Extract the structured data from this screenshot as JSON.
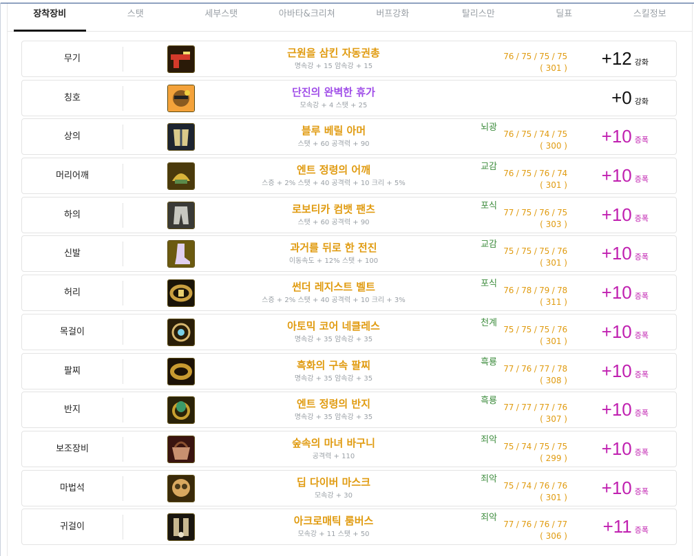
{
  "tabs": [
    "장착장비",
    "스탯",
    "세부스탯",
    "아바타&크리쳐",
    "버프강화",
    "탈리스만",
    "딜표",
    "스킬정보"
  ],
  "active_tab": 0,
  "items": [
    {
      "slot": "무기",
      "name": "근원을 삼킨 자동권총",
      "options": "명속강 + 15 암속강 + 15",
      "emblem": "",
      "stat_line": "76 / 75 / 75 / 75",
      "stat_total": "( 301 )",
      "level": "+12",
      "level_tag": "강화",
      "tier": "legend",
      "mod": "black",
      "icon": "pistol-icon",
      "icon_bg": "#2a1a08",
      "icon_fg": "#d33a2a"
    },
    {
      "slot": "칭호",
      "name": "단진의 완벽한 휴가",
      "options": "모속강 + 4 스탯 + 25",
      "emblem": "",
      "stat_line": "",
      "stat_total": "",
      "level": "+0",
      "level_tag": "강화",
      "tier": "epic",
      "mod": "black",
      "icon": "title-icon",
      "icon_bg": "#f4a23a",
      "icon_fg": "#8a5a20"
    },
    {
      "slot": "상의",
      "name": "블루 베릴 아머",
      "options": "스탯 + 60 공격력 + 90",
      "emblem": "뇌광",
      "stat_line": "76 / 75 / 74 / 75",
      "stat_total": "( 300 )",
      "level": "+10",
      "level_tag": "증폭",
      "tier": "legend",
      "mod": "amp",
      "icon": "armor-icon",
      "icon_bg": "#1d2430",
      "icon_fg": "#d9c98a"
    },
    {
      "slot": "머리어깨",
      "name": "엔트 정령의 어깨",
      "options": "스증 + 2% 스탯 + 40 공격력 + 10 크리 + 5%",
      "emblem": "교감",
      "stat_line": "76 / 75 / 76 / 74",
      "stat_total": "( 301 )",
      "level": "+10",
      "level_tag": "증폭",
      "tier": "legend",
      "mod": "amp",
      "icon": "shoulder-icon",
      "icon_bg": "#4a3a0c",
      "icon_fg": "#d8b43a"
    },
    {
      "slot": "하의",
      "name": "로보티카 컴뱃 팬츠",
      "options": "스탯 + 60 공격력 + 90",
      "emblem": "포식",
      "stat_line": "77 / 75 / 76 / 75",
      "stat_total": "( 303 )",
      "level": "+10",
      "level_tag": "증폭",
      "tier": "legend",
      "mod": "amp",
      "icon": "pants-icon",
      "icon_bg": "#3a3a36",
      "icon_fg": "#c8c8c0"
    },
    {
      "slot": "신발",
      "name": "과거를 뒤로 한 전진",
      "options": "이동속도 + 12% 스탯 + 100",
      "emblem": "교감",
      "stat_line": "75 / 75 / 75 / 76",
      "stat_total": "( 301 )",
      "level": "+10",
      "level_tag": "증폭",
      "tier": "legend",
      "mod": "amp",
      "icon": "boots-icon",
      "icon_bg": "#6b5a10",
      "icon_fg": "#e0d0f0"
    },
    {
      "slot": "허리",
      "name": "썬더 레지스트 벨트",
      "options": "스증 + 2% 스탯 + 40 공격력 + 10 크리 + 3%",
      "emblem": "포식",
      "stat_line": "76 / 78 / 79 / 78",
      "stat_total": "( 311 )",
      "level": "+10",
      "level_tag": "증폭",
      "tier": "legend",
      "mod": "amp",
      "icon": "belt-icon",
      "icon_bg": "#1a1408",
      "icon_fg": "#caa040"
    },
    {
      "slot": "목걸이",
      "name": "아토믹 코어 네클레스",
      "options": "명속강 + 35 암속강 + 35",
      "emblem": "천계",
      "stat_line": "75 / 75 / 75 / 76",
      "stat_total": "( 301 )",
      "level": "+10",
      "level_tag": "증폭",
      "tier": "legend",
      "mod": "amp",
      "icon": "necklace-icon",
      "icon_bg": "#2a1e08",
      "icon_fg": "#d8b870"
    },
    {
      "slot": "팔찌",
      "name": "흑화의 구속 팔찌",
      "options": "명속강 + 35 암속강 + 35",
      "emblem": "흑룡",
      "stat_line": "77 / 76 / 77 / 78",
      "stat_total": "( 308 )",
      "level": "+10",
      "level_tag": "증폭",
      "tier": "legend",
      "mod": "amp",
      "icon": "bracelet-icon",
      "icon_bg": "#1c1206",
      "icon_fg": "#c89a30"
    },
    {
      "slot": "반지",
      "name": "엔트 정령의 반지",
      "options": "명속강 + 35 암속강 + 35",
      "emblem": "흑룡",
      "stat_line": "77 / 77 / 77 / 76",
      "stat_total": "( 307 )",
      "level": "+10",
      "level_tag": "증폭",
      "tier": "legend",
      "mod": "amp",
      "icon": "ring-icon",
      "icon_bg": "#2a2208",
      "icon_fg": "#3a9a6a"
    },
    {
      "slot": "보조장비",
      "name": "숲속의 마녀 바구니",
      "options": "공격력 + 110",
      "emblem": "죄악",
      "stat_line": "75 / 74 / 75 / 75",
      "stat_total": "( 299 )",
      "level": "+10",
      "level_tag": "증폭",
      "tier": "legend",
      "mod": "amp",
      "icon": "basket-icon",
      "icon_bg": "#3a1410",
      "icon_fg": "#c89070"
    },
    {
      "slot": "마법석",
      "name": "딥 다이버 마스크",
      "options": "모속강 + 30",
      "emblem": "죄악",
      "stat_line": "75 / 74 / 76 / 76",
      "stat_total": "( 301 )",
      "level": "+10",
      "level_tag": "증폭",
      "tier": "legend",
      "mod": "amp",
      "icon": "mask-icon",
      "icon_bg": "#3a2a0a",
      "icon_fg": "#d8a860"
    },
    {
      "slot": "귀걸이",
      "name": "아크로매틱 룸버스",
      "options": "모속강 + 11 스탯 + 50",
      "emblem": "죄악",
      "stat_line": "77 / 76 / 76 / 77",
      "stat_total": "( 306 )",
      "level": "+11",
      "level_tag": "증폭",
      "tier": "legend",
      "mod": "amp",
      "icon": "earring-icon",
      "icon_bg": "#1a1610",
      "icon_fg": "#c8b890"
    }
  ],
  "colors": {
    "legend": "#e09b10",
    "epic": "#a04ee8",
    "emblem": "#3d8c3d",
    "amp": "#c020b0",
    "tab_active": "#111111"
  }
}
